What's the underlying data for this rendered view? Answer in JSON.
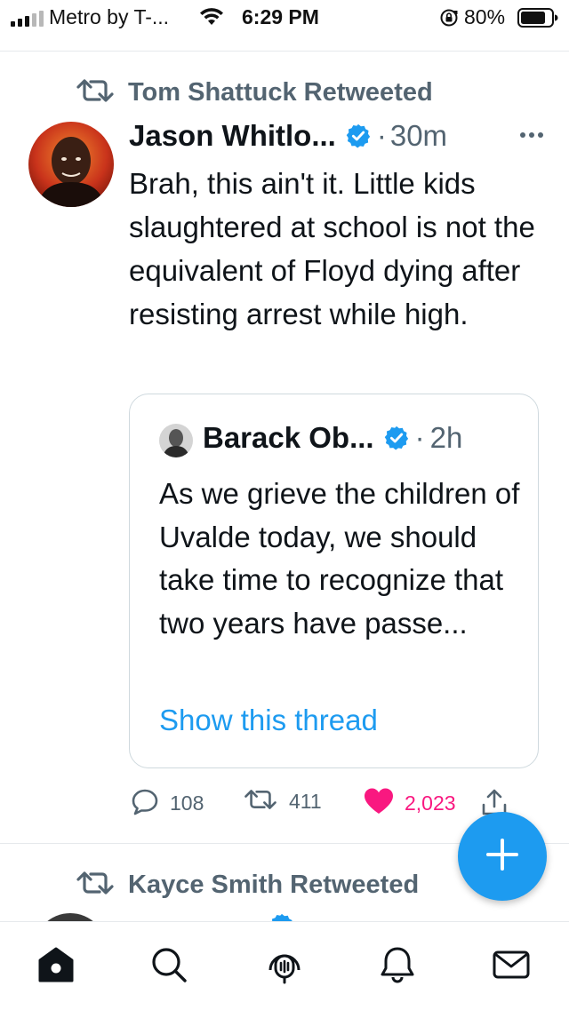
{
  "status_bar": {
    "carrier": "Metro by T-...",
    "time": "6:29 PM",
    "battery_percent": "80%",
    "icons": [
      "signal-icon",
      "wifi-icon",
      "orientation-lock-icon",
      "battery-icon"
    ]
  },
  "tweet": {
    "retweeted_by": "Tom Shattuck Retweeted",
    "author_name": "Jason Whitlo...",
    "time": "30m",
    "separator": "·",
    "text": "Brah, this ain't it. Little kids slaughtered at school is not the equivalent of Floyd dying after resisting arrest while high.",
    "quote": {
      "author_name": "Barack Ob...",
      "time": "2h",
      "text": "As we grieve the children of Uvalde today, we should take time to recognize that two years have passe...",
      "show_thread": "Show this thread"
    },
    "actions": {
      "replies": "108",
      "retweets": "411",
      "likes": "2,023",
      "liked": true
    }
  },
  "next_tweet": {
    "retweeted_by": "Kayce Smith Retweeted"
  },
  "tabbar": {
    "tabs": [
      "home-icon",
      "search-icon",
      "spaces-icon",
      "notifications-icon",
      "messages-icon"
    ]
  },
  "colors": {
    "accent": "#1d9bf0",
    "like": "#f91880",
    "muted": "#536471",
    "text": "#0f1419"
  }
}
